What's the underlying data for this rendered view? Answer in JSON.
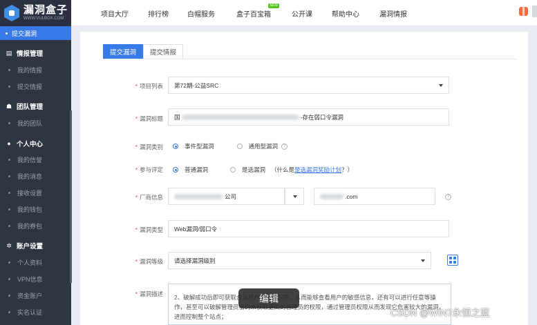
{
  "logo": {
    "title": "漏洞盒子",
    "subtitle": "WWW.VULBOX.COM"
  },
  "sidebar": {
    "active_item": "提交漏洞",
    "groups": [
      {
        "label": "情报管理",
        "icon": "list-icon",
        "items": [
          "我的情报",
          "提交情报"
        ]
      },
      {
        "label": "团队管理",
        "icon": "team-icon",
        "items": [
          "我的团队"
        ]
      },
      {
        "label": "个人中心",
        "icon": "user-icon",
        "items": [
          "我的信誉",
          "我的消息",
          "接收设置",
          "我的钱包",
          "我的券包"
        ]
      },
      {
        "label": "账户设置",
        "icon": "gear-icon",
        "items": [
          "个人资料",
          "VPN信息",
          "资金账户",
          "实名认证"
        ]
      }
    ]
  },
  "topnav": {
    "items": [
      "项目大厅",
      "排行榜",
      "白帽服务",
      "盒子百宝箱",
      "公开课",
      "帮助中心",
      "漏洞情报"
    ],
    "new_badge": "NEW"
  },
  "tabs": [
    "提交漏洞",
    "提交情报"
  ],
  "form": {
    "project": {
      "label": "项目列表",
      "value": "第72期-公益SRC"
    },
    "title": {
      "label": "漏洞标题",
      "prefix": "国",
      "suffix": "-存在弱口令漏洞"
    },
    "category": {
      "label": "漏洞类别",
      "options": [
        "事件型漏洞",
        "通用型漏洞"
      ],
      "selected": 0
    },
    "review": {
      "label": "参与评定",
      "options": [
        "普通漏洞",
        "是选漏洞"
      ],
      "hint_prefix": "（什么是",
      "hint_link": "是选漏洞奖励计划",
      "hint_suffix": "？）",
      "selected": 0
    },
    "vendor": {
      "label": "厂商信息",
      "company_suffix": "公司",
      "domain_suffix": ".com"
    },
    "type": {
      "label": "漏洞类型",
      "value": "Web漏洞/弱口令"
    },
    "level": {
      "label": "漏洞等级",
      "value": "请选择漏洞级别"
    },
    "desc": {
      "label": "漏洞描述",
      "text": "2、破解成功后即可获取合法用户的访问权限，从而能够查看用户的敏感信息，还有可以进行任意等操作，甚至可以破解管理员密码来获取更高的管理员的权限，通过管理员权限从而发现它危害较大的漏洞，进而控制整个站点；"
    }
  },
  "overlay": {
    "edit_label": "编辑",
    "watermark": "CSDN @WIN7永恒之蓝"
  }
}
